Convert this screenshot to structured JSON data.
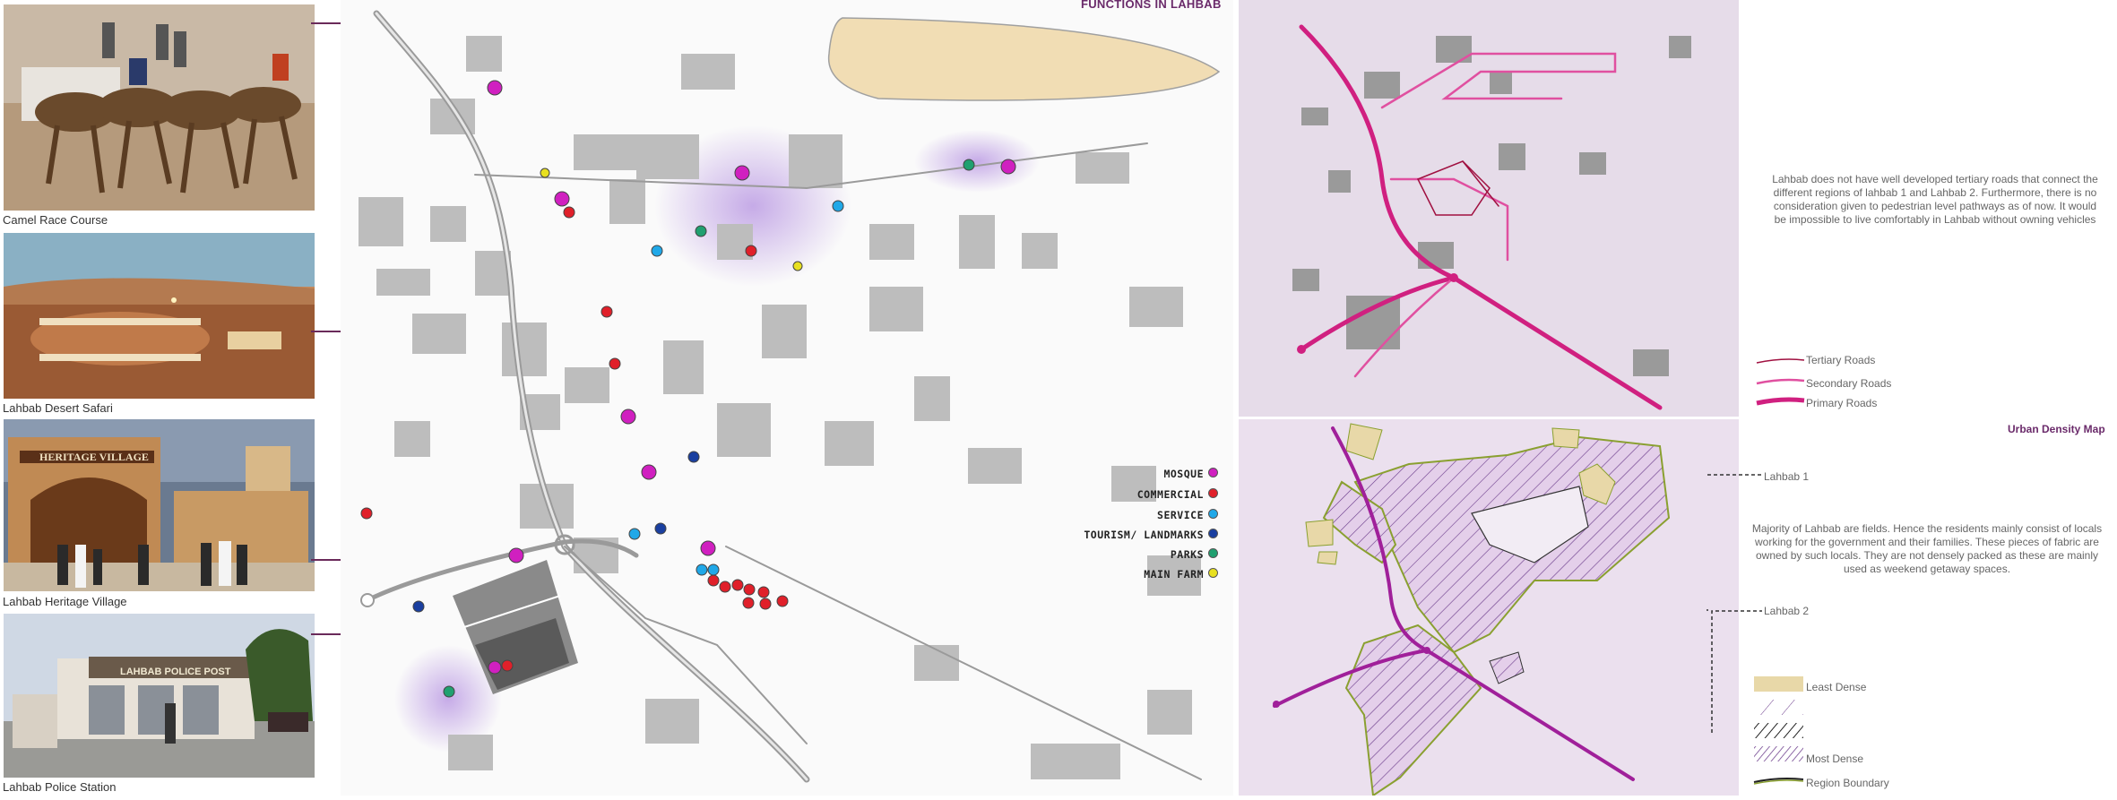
{
  "map_title": "FUNCTIONS IN LAHBAB",
  "photos": [
    {
      "caption": "Camel Race Course"
    },
    {
      "caption": "Lahbab Desert Safari"
    },
    {
      "caption": "Lahbab Heritage Village",
      "sign": "HERITAGE VILLAGE"
    },
    {
      "caption": "Lahbab Police Station",
      "sign": "LAHBAB POLICE POST"
    }
  ],
  "legend": [
    {
      "label": "MOSQUE",
      "color": "#d020c0"
    },
    {
      "label": "COMMERCIAL",
      "color": "#e0202a"
    },
    {
      "label": "SERVICE",
      "color": "#20a8e8"
    },
    {
      "label": "TOURISM/ LANDMARKS",
      "color": "#1a3fa0"
    },
    {
      "label": "PARKS",
      "color": "#20a070"
    },
    {
      "label": "MAIN FARM",
      "color": "#e8e020"
    }
  ],
  "road_panel": {
    "description": "Lahbab does not have well developed tertiary roads that connect the different regions of lahbab 1 and Lahbab  2. Furthermore, there is no consideration given to pedestrian level  pathways as of now. It would be impossible to live comfortably in Lahbab without owning vehicles",
    "legend": [
      {
        "label": "Tertiary Roads",
        "color": "#a01040"
      },
      {
        "label": "Secondary Roads",
        "color": "#e050a0"
      },
      {
        "label": "Primary Roads",
        "color": "#d02080"
      }
    ]
  },
  "density_panel": {
    "title": "Urban Density Map",
    "label_1": "Lahbab 1",
    "label_2": "Lahbab 2",
    "description": "Majority of Lahbab are fields. Hence the residents mainly consist of locals working for the government and their families. These pieces of fabric are owned by such locals. They are not densely packed as these are mainly used as weekend getaway spaces.",
    "legend": [
      {
        "label": "Least Dense"
      },
      {
        "label": ""
      },
      {
        "label": ""
      },
      {
        "label": "Most Dense"
      },
      {
        "label": "Region Boundary"
      }
    ]
  }
}
